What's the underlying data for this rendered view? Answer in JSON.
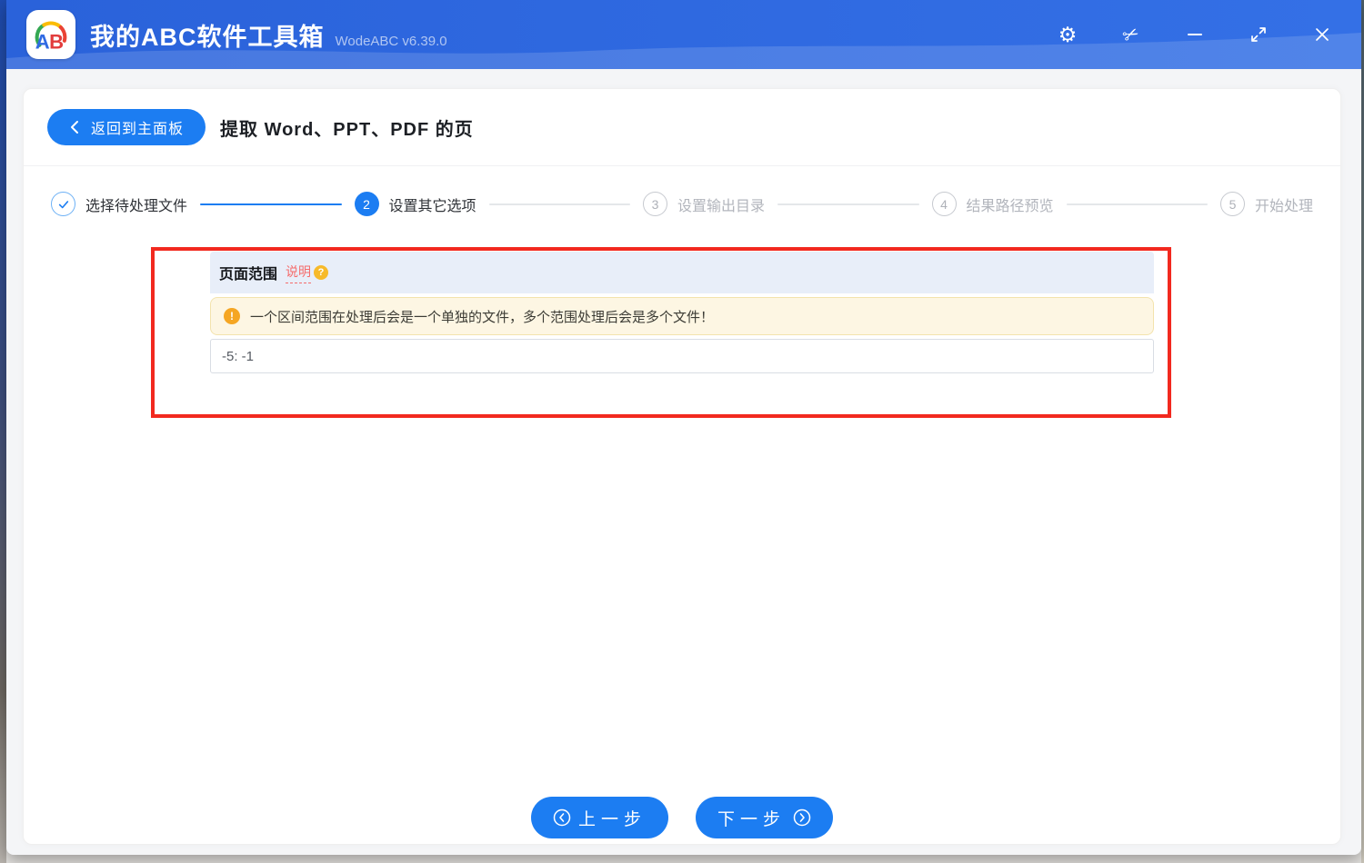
{
  "titlebar": {
    "app_title": "我的ABC软件工具箱",
    "version": "WodeABC v6.39.0",
    "logo_text_a": "A",
    "logo_text_b": "B",
    "icons": {
      "settings": "⚙",
      "snip": "✂"
    }
  },
  "header": {
    "back_button": "返回到主面板",
    "page_title": "提取 Word、PPT、PDF 的页"
  },
  "stepper": {
    "steps": [
      {
        "number": "1",
        "label": "选择待处理文件",
        "state": "done"
      },
      {
        "number": "2",
        "label": "设置其它选项",
        "state": "active"
      },
      {
        "number": "3",
        "label": "设置输出目录",
        "state": "pending"
      },
      {
        "number": "4",
        "label": "结果路径预览",
        "state": "pending"
      },
      {
        "number": "5",
        "label": "开始处理",
        "state": "pending"
      }
    ]
  },
  "section": {
    "title": "页面范围",
    "help_link": "说明",
    "help_icon": "?",
    "warning_icon": "!",
    "warning": "一个区间范围在处理后会是一个单独的文件，多个范围处理后会是多个文件！",
    "range_value": "-5: -1"
  },
  "footer": {
    "prev": "上一步",
    "next": "下一步"
  },
  "colors": {
    "accent": "#1c7df2",
    "titlebar_blue": "#2b66dd",
    "annotation_red": "#f2291f",
    "section_header_bg": "#e8eef9",
    "warning_bg": "#fdf6e3",
    "warning_orange": "#f5a623",
    "help_orange": "#f7ba2a",
    "help_red": "#f56c6c"
  }
}
